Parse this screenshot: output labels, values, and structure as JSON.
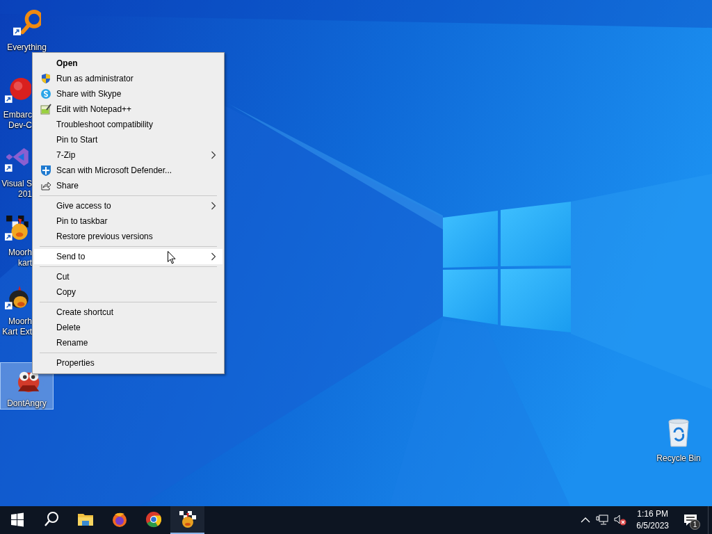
{
  "desktop_icons": [
    {
      "lines": [
        "Everything"
      ],
      "selected": false
    },
    {
      "lines": [
        "Embarc",
        "Dev-C"
      ],
      "selected": false
    },
    {
      "lines": [
        "Visual S",
        "201"
      ],
      "selected": false
    },
    {
      "lines": [
        "Moorh",
        "kart"
      ],
      "selected": false
    },
    {
      "lines": [
        "Moorh",
        "Kart Ext"
      ],
      "selected": false
    },
    {
      "lines": [
        "DontAngry"
      ],
      "selected": true
    }
  ],
  "recycle_bin": {
    "label": "Recycle Bin"
  },
  "context_menu": {
    "groups": [
      [
        {
          "label": "Open",
          "default": true,
          "submenu": false,
          "selected": false
        },
        {
          "label": "Run as administrator",
          "default": false,
          "submenu": false,
          "selected": false
        },
        {
          "label": "Share with Skype",
          "default": false,
          "submenu": false,
          "selected": false
        },
        {
          "label": "Edit with Notepad++",
          "default": false,
          "submenu": false,
          "selected": false
        },
        {
          "label": "Troubleshoot compatibility",
          "default": false,
          "submenu": false,
          "selected": false
        },
        {
          "label": "Pin to Start",
          "default": false,
          "submenu": false,
          "selected": false
        },
        {
          "label": "7-Zip",
          "default": false,
          "submenu": true,
          "selected": false
        },
        {
          "label": "Scan with Microsoft Defender...",
          "default": false,
          "submenu": false,
          "selected": false
        },
        {
          "label": "Share",
          "default": false,
          "submenu": false,
          "selected": false
        }
      ],
      [
        {
          "label": "Give access to",
          "default": false,
          "submenu": true,
          "selected": false
        },
        {
          "label": "Pin to taskbar",
          "default": false,
          "submenu": false,
          "selected": false
        },
        {
          "label": "Restore previous versions",
          "default": false,
          "submenu": false,
          "selected": false
        }
      ],
      [
        {
          "label": "Send to",
          "default": false,
          "submenu": true,
          "selected": true
        }
      ],
      [
        {
          "label": "Cut",
          "default": false,
          "submenu": false,
          "selected": false
        },
        {
          "label": "Copy",
          "default": false,
          "submenu": false,
          "selected": false
        }
      ],
      [
        {
          "label": "Create shortcut",
          "default": false,
          "submenu": false,
          "selected": false
        },
        {
          "label": "Delete",
          "default": false,
          "submenu": false,
          "selected": false
        },
        {
          "label": "Rename",
          "default": false,
          "submenu": false,
          "selected": false
        }
      ],
      [
        {
          "label": "Properties",
          "default": false,
          "submenu": false,
          "selected": false
        }
      ]
    ]
  },
  "taskbar": {
    "apps": [
      {
        "active": false
      },
      {
        "active": false
      },
      {
        "active": false
      },
      {
        "active": false
      },
      {
        "active": false
      },
      {
        "active": true
      }
    ],
    "clock": {
      "time": "1:16 PM",
      "date": "6/5/2023"
    },
    "notifications": {
      "count": "1"
    }
  }
}
